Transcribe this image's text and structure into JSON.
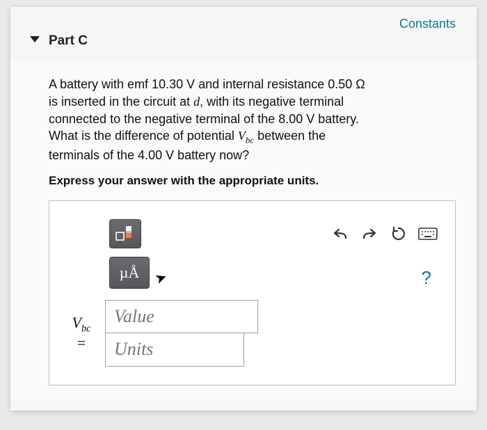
{
  "header": {
    "constants_link": "Constants",
    "part_label": "Part C"
  },
  "question": {
    "text_l1": "A battery with emf 10.30 V and internal resistance 0.50 Ω",
    "text_l2a": "is inserted in the circuit at ",
    "var_d": "d",
    "text_l2b": ", with its negative terminal",
    "text_l3": "connected to the negative terminal of the 8.00 V battery.",
    "text_l4a": "What is the difference of potential ",
    "var_V": "V",
    "var_bc": "bc",
    "text_l4b": " between the",
    "text_l5": "terminals of the 4.00 V battery now?"
  },
  "instruction": "Express your answer with the appropriate units.",
  "toolbar": {
    "template_label": "template",
    "muA_label": "µÅ",
    "help_label": "?"
  },
  "answer": {
    "lhs_V": "V",
    "lhs_bc": "bc",
    "equals": "=",
    "value_placeholder": "Value",
    "units_placeholder": "Units"
  }
}
